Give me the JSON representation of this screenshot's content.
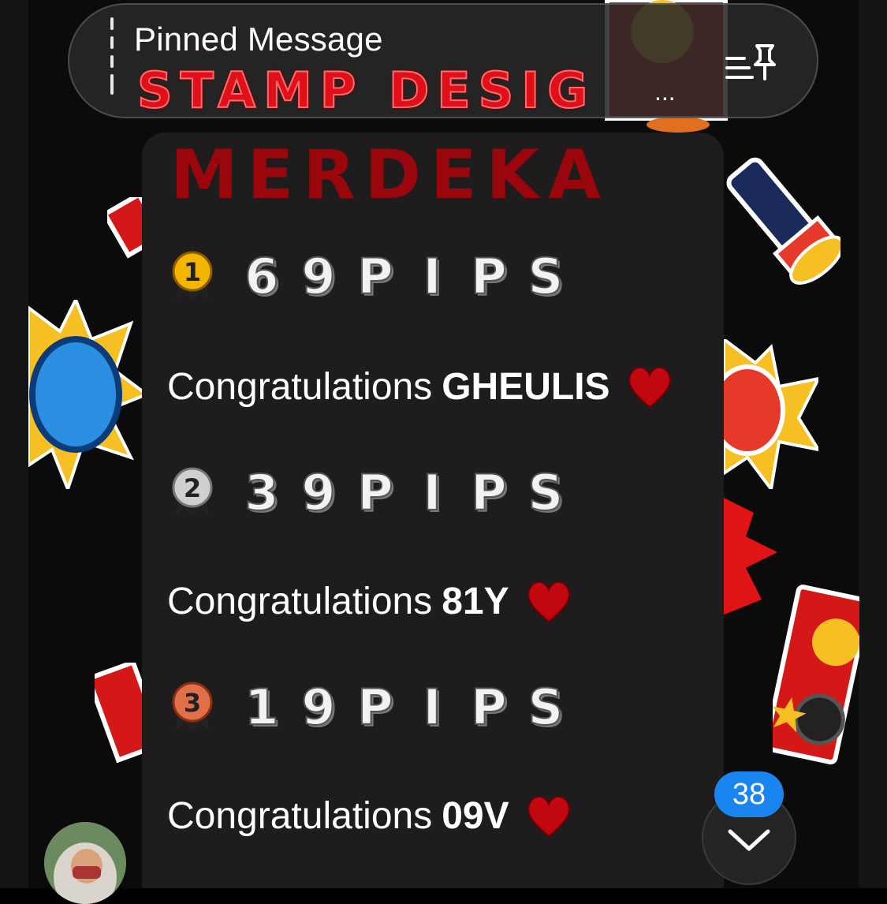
{
  "pinned": {
    "title": "Pinned Message",
    "preview": "STAMP DESIG",
    "ellipsis": "..."
  },
  "message": {
    "header": "MERDEKA",
    "ranks": [
      {
        "medal": "gold-1",
        "digits": [
          "6",
          "9",
          "P",
          "I",
          "P",
          "S"
        ],
        "congrats": "Congratulations",
        "name": "GHEULIS"
      },
      {
        "medal": "silver-2",
        "digits": [
          "3",
          "9",
          "P",
          "I",
          "P",
          "S"
        ],
        "congrats": "Congratulations",
        "name": "81Y"
      },
      {
        "medal": "bronze-3",
        "digits": [
          "1",
          "9",
          "P",
          "I",
          "P",
          "S"
        ],
        "congrats": "Congratulations",
        "name": "09V"
      }
    ]
  },
  "scroll": {
    "unread_count": "38"
  },
  "colors": {
    "badge": "#1a84f0",
    "bubble": "#1e1c1c",
    "accent_red": "#e0101a"
  }
}
